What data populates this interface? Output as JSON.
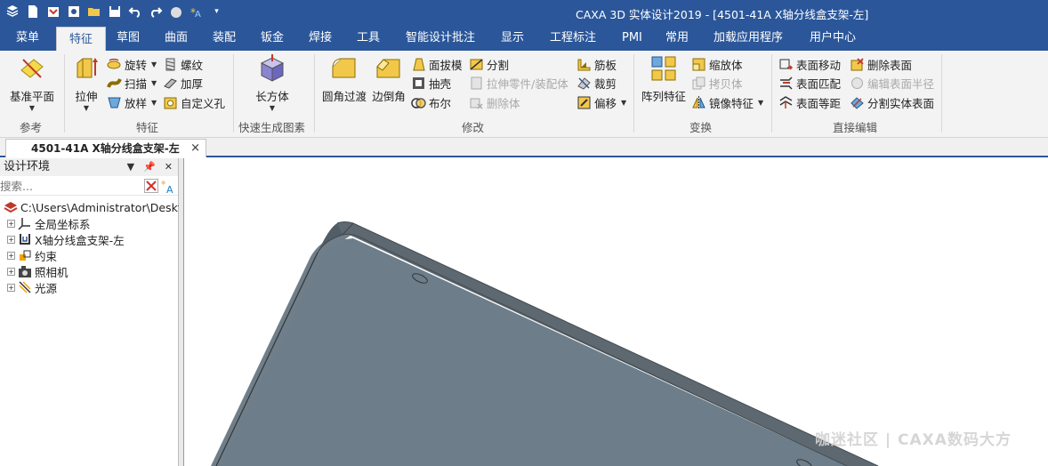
{
  "window": {
    "title": "CAXA 3D 实体设计2019 - [4501-41A X轴分线盒支架-左]",
    "quick_access_icons": [
      "app-menu-icon",
      "new-file-icon",
      "new-mail-icon",
      "save-as-icon",
      "open-folder-icon",
      "save-icon",
      "undo-icon",
      "redo-icon",
      "render-icon",
      "smart-icon",
      "customize-dropdown-icon"
    ]
  },
  "menu": {
    "tabs": [
      "菜单",
      "特征",
      "草图",
      "曲面",
      "装配",
      "钣金",
      "焊接",
      "工具",
      "智能设计批注",
      "显示",
      "工程标注",
      "PMI",
      "常用",
      "加载应用程序",
      "用户中心"
    ],
    "active": "特征"
  },
  "ribbon": {
    "groups": {
      "ref": "参考",
      "feature": "特征",
      "quick": "快速生成图素",
      "modify": "修改",
      "transform": "变换",
      "direct": "直接编辑"
    },
    "ref_plane": "基准平面",
    "extrude": "拉伸",
    "revolve": "旋转",
    "sweep": "扫描",
    "loft": "放样",
    "thread": "螺纹",
    "thicken": "加厚",
    "custom_hole": "自定义孔",
    "box": "长方体",
    "fillet": "圆角过渡",
    "chamfer": "边倒角",
    "draft": "面拔模",
    "shell": "抽壳",
    "boolean": "布尔",
    "split": "分割",
    "extrude_to_part": "拉伸零件/装配体",
    "delete_body": "删除体",
    "rib": "筋板",
    "trim": "裁剪",
    "offset": "偏移",
    "pattern": "阵列特征",
    "scale": "缩放体",
    "copy_body": "拷贝体",
    "mirror": "镜像特征",
    "move_face": "表面移动",
    "match_face": "表面匹配",
    "offset_face": "表面等距",
    "delete_face": "删除表面",
    "edit_radius": "编辑表面半径",
    "split_solid_face": "分割实体表面"
  },
  "document_tab": {
    "label": "4501-41A X轴分线盒支架-左",
    "close": "×"
  },
  "design_panel": {
    "title": "设计环境",
    "search_placeholder": "搜索...",
    "root_path": "C:\\Users\\Administrator\\Deskt",
    "items": [
      "全局坐标系",
      "X轴分线盒支架-左",
      "约束",
      "照相机",
      "光源"
    ]
  },
  "watermark": "咖迷社区 | CAXA数码大方"
}
